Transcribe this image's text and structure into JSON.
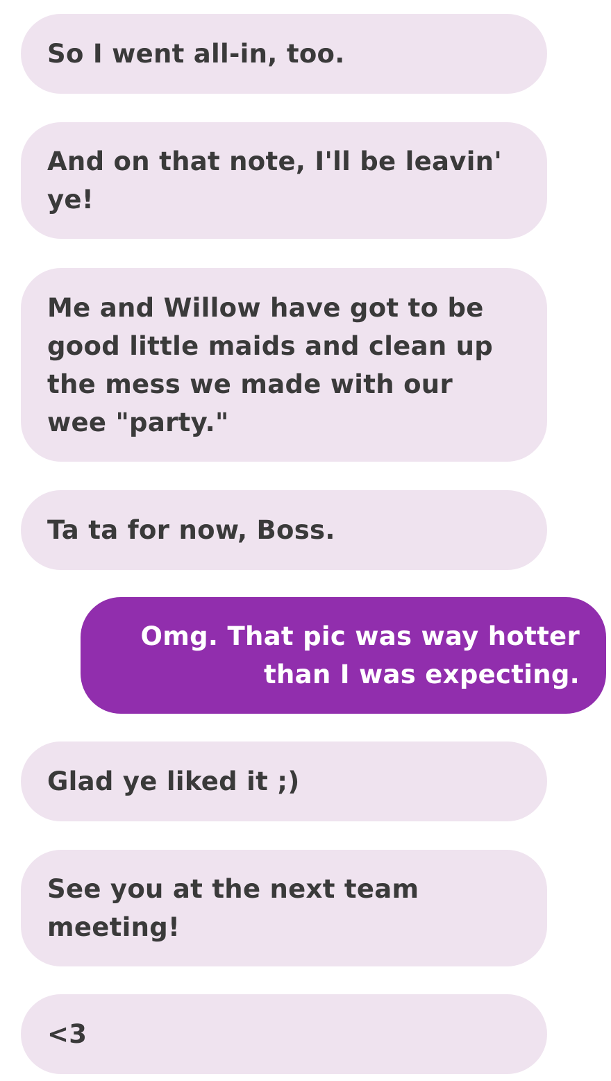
{
  "conversation": {
    "messages": [
      {
        "sender": "contact",
        "text": "So I went all-in, too."
      },
      {
        "sender": "contact",
        "text": "And on that note, I'll be leavin' ye!"
      },
      {
        "sender": "contact",
        "text": "Me and Willow have got to be good little maids and clean up the mess we made with our wee \"party.\""
      },
      {
        "sender": "contact",
        "text": "Ta ta for now, Boss."
      },
      {
        "sender": "me",
        "text": "Omg. That pic was way hotter than I was expecting."
      },
      {
        "sender": "contact",
        "text": "Glad ye liked it ;)"
      },
      {
        "sender": "contact",
        "text": "See you at the next team meeting!"
      },
      {
        "sender": "contact",
        "text": "<3"
      }
    ]
  },
  "colors": {
    "incoming_bubble": "#efe3ef",
    "incoming_text": "#3a3a3a",
    "outgoing_bubble": "#912ead",
    "outgoing_text": "#ffffff"
  }
}
